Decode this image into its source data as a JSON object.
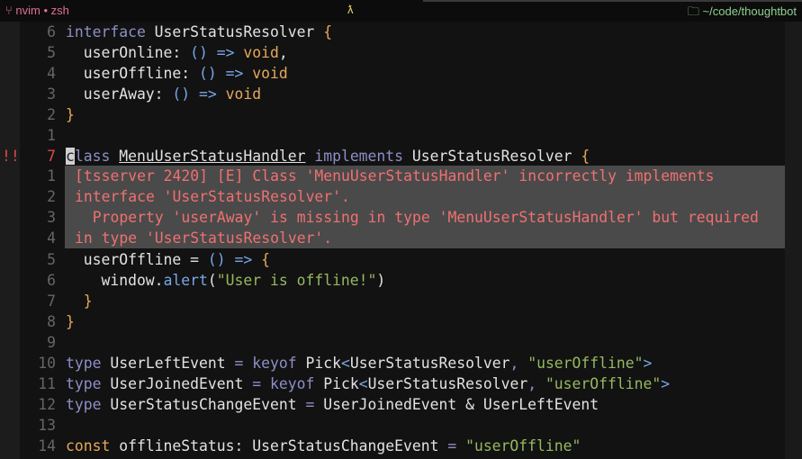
{
  "topbar": {
    "left_label": "nvim • zsh",
    "left_icon": "git-branch-icon",
    "middle_icon": "lambda-icon",
    "right_label": "~/code/thoughtbot",
    "right_icon": "folder-icon"
  },
  "colors": {
    "keyword": "#8e8ec8",
    "orange": "#e6a85c",
    "blue": "#78a6e6",
    "string": "#95b860",
    "error": "#f07070",
    "popup_bg": "#4a4a4a"
  },
  "lines": [
    {
      "num": "6",
      "segs": [
        [
          "kw",
          "interface"
        ],
        [
          "id",
          " UserStatusResolver "
        ],
        [
          "or",
          "{"
        ]
      ]
    },
    {
      "num": "5",
      "segs": [
        [
          "id",
          "  userOnline: "
        ],
        [
          "bl",
          "() =>"
        ],
        [
          "id",
          " "
        ],
        [
          "or",
          "void"
        ],
        [
          "id",
          ","
        ]
      ]
    },
    {
      "num": "4",
      "segs": [
        [
          "id",
          "  userOffline: "
        ],
        [
          "bl",
          "() =>"
        ],
        [
          "id",
          " "
        ],
        [
          "or",
          "void"
        ]
      ]
    },
    {
      "num": "3",
      "segs": [
        [
          "id",
          "  userAway: "
        ],
        [
          "bl",
          "() =>"
        ],
        [
          "id",
          " "
        ],
        [
          "or",
          "void"
        ]
      ]
    },
    {
      "num": "2",
      "segs": [
        [
          "or",
          "}"
        ]
      ]
    },
    {
      "num": "1",
      "segs": []
    },
    {
      "num": "7",
      "sign": "!!",
      "segs": [
        [
          "cursor",
          "c"
        ],
        [
          "kw",
          "lass"
        ],
        [
          "id",
          " "
        ],
        [
          "id ul",
          "MenuUserStatusHandler"
        ],
        [
          "id",
          " "
        ],
        [
          "kw",
          "implements"
        ],
        [
          "id",
          " UserStatusResolver "
        ],
        [
          "or",
          "{"
        ]
      ]
    },
    {
      "num": "",
      "segs": []
    },
    {
      "num": "",
      "segs": []
    },
    {
      "num": "",
      "segs": []
    },
    {
      "num": "",
      "segs": []
    },
    {
      "num": "5",
      "segs": [
        [
          "id",
          "  userOffline = "
        ],
        [
          "bl",
          "() =>"
        ],
        [
          "id",
          " "
        ],
        [
          "or",
          "{"
        ]
      ]
    },
    {
      "num": "6",
      "segs": [
        [
          "id",
          "    window."
        ],
        [
          "bl",
          "alert"
        ],
        [
          "id",
          "("
        ],
        [
          "st",
          "\"User is offline!\""
        ],
        [
          "id",
          ")"
        ]
      ]
    },
    {
      "num": "7",
      "segs": [
        [
          "or",
          "  }"
        ]
      ]
    },
    {
      "num": "8",
      "segs": [
        [
          "or",
          "}"
        ]
      ]
    },
    {
      "num": "9",
      "segs": []
    },
    {
      "num": "10",
      "segs": [
        [
          "kw",
          "type"
        ],
        [
          "id",
          " UserLeftEvent "
        ],
        [
          "kw",
          "="
        ],
        [
          "id",
          " "
        ],
        [
          "kw",
          "keyof"
        ],
        [
          "id",
          " Pick"
        ],
        [
          "bl",
          "<"
        ],
        [
          "id",
          "UserStatusResolver"
        ],
        [
          "kw",
          ","
        ],
        [
          "id",
          " "
        ],
        [
          "st",
          "\"userOffline\""
        ],
        [
          "bl",
          ">"
        ]
      ]
    },
    {
      "num": "11",
      "segs": [
        [
          "kw",
          "type"
        ],
        [
          "id",
          " UserJoinedEvent "
        ],
        [
          "kw",
          "="
        ],
        [
          "id",
          " "
        ],
        [
          "kw",
          "keyof"
        ],
        [
          "id",
          " Pick"
        ],
        [
          "bl",
          "<"
        ],
        [
          "id",
          "UserStatusResolver"
        ],
        [
          "kw",
          ","
        ],
        [
          "id",
          " "
        ],
        [
          "st",
          "\"userOffline\""
        ],
        [
          "bl",
          ">"
        ]
      ]
    },
    {
      "num": "12",
      "segs": [
        [
          "kw",
          "type"
        ],
        [
          "id",
          " UserStatusChangeEvent "
        ],
        [
          "kw",
          "="
        ],
        [
          "id",
          " UserJoinedEvent & UserLeftEvent"
        ]
      ]
    },
    {
      "num": "13",
      "segs": []
    },
    {
      "num": "14",
      "segs": [
        [
          "or",
          "const"
        ],
        [
          "id",
          " offlineStatus: UserStatusChangeEvent "
        ],
        [
          "kw",
          "="
        ],
        [
          "id",
          " "
        ],
        [
          "st",
          "\"userOffline\""
        ]
      ]
    }
  ],
  "diagnostic": {
    "lines": [
      {
        "num": "1",
        "text": "[tsserver 2420] [E] Class 'MenuUserStatusHandler' incorrectly implements"
      },
      {
        "num": "2",
        "text": "interface 'UserStatusResolver'."
      },
      {
        "num": "3",
        "text": "  Property 'userAway' is missing in type 'MenuUserStatusHandler' but required"
      },
      {
        "num": "4",
        "text": "in type 'UserStatusResolver'."
      }
    ]
  }
}
